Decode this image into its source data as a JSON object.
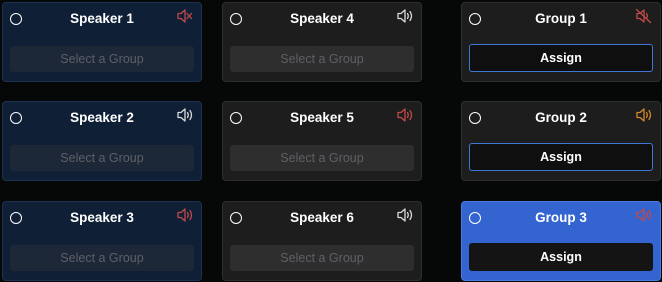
{
  "speakers": [
    {
      "name": "Speaker 1",
      "placeholder": "Select a Group",
      "icon": "speaker-muted-icon",
      "icon_color": "#c04a4a"
    },
    {
      "name": "Speaker 2",
      "placeholder": "Select a Group",
      "icon": "speaker-volume-icon",
      "icon_color": "#d9d9d9"
    },
    {
      "name": "Speaker 3",
      "placeholder": "Select a Group",
      "icon": "speaker-volume-icon",
      "icon_color": "#c04a4a"
    },
    {
      "name": "Speaker 4",
      "placeholder": "Select a Group",
      "icon": "speaker-volume-icon",
      "icon_color": "#d9d9d9"
    },
    {
      "name": "Speaker 5",
      "placeholder": "Select a Group",
      "icon": "speaker-volume-icon",
      "icon_color": "#c04a4a"
    },
    {
      "name": "Speaker 6",
      "placeholder": "Select a Group",
      "icon": "speaker-volume-icon",
      "icon_color": "#d9d9d9"
    }
  ],
  "groups": [
    {
      "name": "Group 1",
      "button": "Assign",
      "icon": "speaker-muted-icon",
      "icon_color": "#c04a4a",
      "selected": false
    },
    {
      "name": "Group 2",
      "button": "Assign",
      "icon": "speaker-volume-icon",
      "icon_color": "#d08a2a",
      "selected": false
    },
    {
      "name": "Group 3",
      "button": "Assign",
      "icon": "speaker-volume-icon",
      "icon_color": "#c04a4a",
      "selected": true
    }
  ]
}
